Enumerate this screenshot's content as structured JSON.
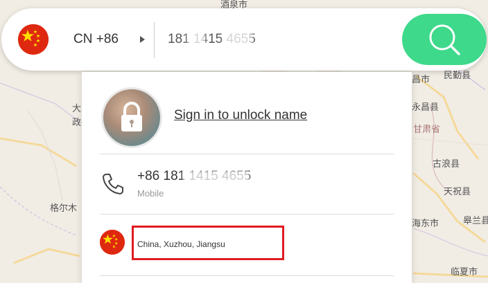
{
  "map": {
    "labels": [
      "酒泉市",
      "大",
      "政",
      "格尔木",
      "昌市",
      "民勤县",
      "永昌县",
      "甘肃省",
      "古浪县",
      "天祝县",
      "海东市",
      "皋兰县",
      "临夏市"
    ]
  },
  "search": {
    "country_code": "CN +86",
    "phone_value": "181 1415 4655",
    "flag_icon": "china-flag-icon",
    "search_icon": "search-icon"
  },
  "result": {
    "unlock_text": "Sign in to unlock name",
    "phone_number": "+86 181 1415 4655",
    "phone_type": "Mobile",
    "location": "China, Xuzhou, Jiangsu",
    "avatar_icon": "lock-icon",
    "phone_icon": "phone-icon"
  },
  "colors": {
    "accent_green": "#3ed98b",
    "highlight_red": "#e01b22",
    "flag_red": "#de2910",
    "flag_yellow": "#ffde00"
  }
}
